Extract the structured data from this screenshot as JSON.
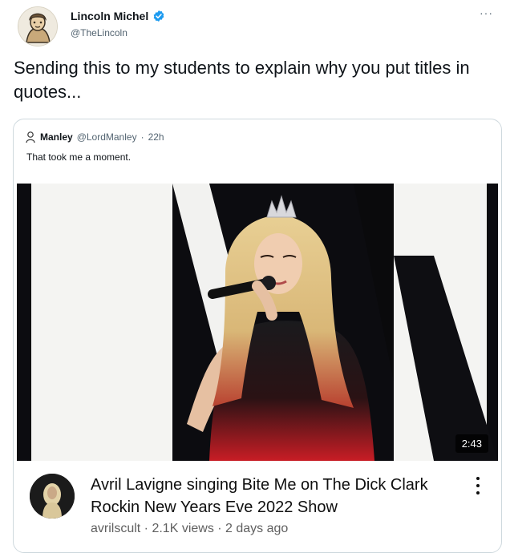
{
  "tweet": {
    "author_name": "Lincoln Michel",
    "author_handle": "@TheLincoln",
    "more_glyph": "···",
    "text": "Sending this to my students to explain why you put titles in quotes..."
  },
  "quoted_tweet": {
    "author_name": "Manley",
    "author_handle": "@LordManley",
    "separator": "·",
    "time": "22h",
    "text": "That took me a moment."
  },
  "video": {
    "duration": "2:43",
    "title": "Avril Lavigne singing Bite Me on The Dick Clark Rockin New Years Eve 2022 Show",
    "meta": "avrilscult · 2.1K views · 2 days ago"
  },
  "colors": {
    "verified": "#1d9bf0",
    "text_primary": "#0f1419",
    "text_secondary": "#536471",
    "border": "#cfd9de"
  },
  "icons": [
    "avatar",
    "verified-badge-icon",
    "more-icon",
    "quote-avatar",
    "channel-avatar",
    "kebab-menu-icon"
  ]
}
